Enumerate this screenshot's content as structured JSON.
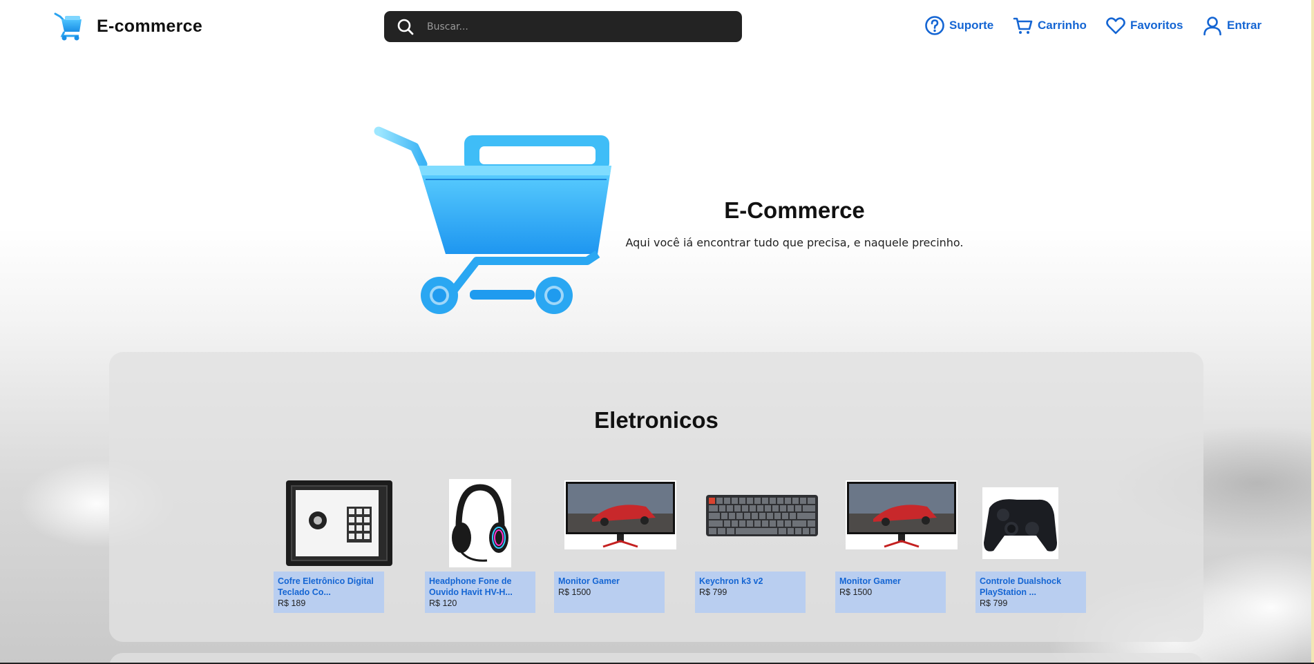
{
  "header": {
    "brand": "E-commerce",
    "search": {
      "placeholder": "Buscar..."
    },
    "nav": [
      {
        "label": "Suporte",
        "icon": "help-circle-icon"
      },
      {
        "label": "Carrinho",
        "icon": "cart-icon"
      },
      {
        "label": "Favoritos",
        "icon": "heart-icon"
      },
      {
        "label": "Entrar",
        "icon": "user-icon"
      }
    ]
  },
  "hero": {
    "title": "E-Commerce",
    "subtitle": "Aqui você iá encontrar tudo que precisa, e naquele precinho."
  },
  "section": {
    "title": "Eletronicos",
    "products": [
      {
        "name": "Cofre Eletrônico Digital Teclado Co...",
        "price": "R$ 189",
        "image": "safe"
      },
      {
        "name": "Headphone Fone de Ouvido Havit HV-H...",
        "price": "R$ 120",
        "image": "headphone"
      },
      {
        "name": "Monitor Gamer",
        "price": "R$ 1500",
        "image": "monitor"
      },
      {
        "name": "Keychron k3 v2",
        "price": "R$ 799",
        "image": "keyboard"
      },
      {
        "name": "Monitor Gamer",
        "price": "R$ 1500",
        "image": "monitor"
      },
      {
        "name": "Controle Dualshock PlayStation ...",
        "price": "R$ 799",
        "image": "controller"
      }
    ]
  },
  "colors": {
    "accent": "#1465d3",
    "search_bg": "#232323",
    "card_bg": "#b9cef0",
    "cart_blue": "#29a6f2"
  }
}
